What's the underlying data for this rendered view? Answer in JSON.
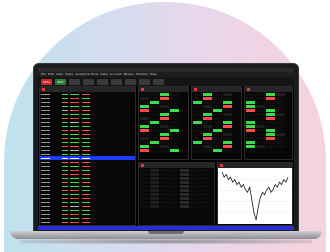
{
  "menu": [
    "File",
    "Edit",
    "View",
    "Trade",
    "Analytical Tools",
    "Data",
    "Account",
    "Mosaic",
    "Window",
    "Help"
  ],
  "toolbar": [
    {
      "label": "SELL",
      "kind": "sell"
    },
    {
      "label": "BUY",
      "kind": "buy"
    },
    {
      "label": "",
      "kind": "btn"
    },
    {
      "label": "",
      "kind": "btn"
    },
    {
      "label": "",
      "kind": "btn"
    },
    {
      "label": "",
      "kind": "btn"
    },
    {
      "label": "",
      "kind": "btn"
    },
    {
      "label": "",
      "kind": "btn"
    },
    {
      "label": "",
      "kind": "btn"
    }
  ],
  "watchlist_rows": [
    {
      "s": "n",
      "c": [
        "pos",
        "pos",
        "neg"
      ]
    },
    {
      "s": "n",
      "c": [
        "pos",
        "neg",
        "pos"
      ]
    },
    {
      "s": "n",
      "c": [
        "neg",
        "neg",
        "neg"
      ]
    },
    {
      "s": "n",
      "c": [
        "pos",
        "pos",
        "pos"
      ]
    },
    {
      "s": "n",
      "c": [
        "neu",
        "neg",
        "neg"
      ]
    },
    {
      "s": "n",
      "c": [
        "pos",
        "pos",
        "pos"
      ]
    },
    {
      "s": "n",
      "c": [
        "neg",
        "neg",
        "pos"
      ]
    },
    {
      "s": "n",
      "c": [
        "pos",
        "neu",
        "neg"
      ]
    },
    {
      "s": "n",
      "c": [
        "pos",
        "pos",
        "pos"
      ]
    },
    {
      "s": "n",
      "c": [
        "neg",
        "neg",
        "neg"
      ]
    },
    {
      "s": "n",
      "c": [
        "pos",
        "pos",
        "neg"
      ]
    },
    {
      "s": "n",
      "c": [
        "neg",
        "pos",
        "pos"
      ]
    },
    {
      "s": "n",
      "c": [
        "pos",
        "pos",
        "pos"
      ]
    },
    {
      "s": "n",
      "c": [
        "neg",
        "neg",
        "pos"
      ]
    },
    {
      "s": "n",
      "c": [
        "pos",
        "neu",
        "neg"
      ]
    },
    {
      "s": "n",
      "c": [
        "pos",
        "pos",
        "pos"
      ]
    },
    {
      "s": "sel",
      "c": [
        "neu",
        "neu",
        "neu"
      ]
    },
    {
      "s": "n",
      "c": [
        "neg",
        "neg",
        "neg"
      ]
    },
    {
      "s": "n",
      "c": [
        "pos",
        "pos",
        "neg"
      ]
    },
    {
      "s": "n",
      "c": [
        "pos",
        "neg",
        "pos"
      ]
    },
    {
      "s": "n",
      "c": [
        "neg",
        "neg",
        "neg"
      ]
    },
    {
      "s": "n",
      "c": [
        "pos",
        "pos",
        "pos"
      ]
    },
    {
      "s": "n",
      "c": [
        "neg",
        "pos",
        "neg"
      ]
    },
    {
      "s": "n",
      "c": [
        "pos",
        "pos",
        "pos"
      ]
    },
    {
      "s": "n",
      "c": [
        "neg",
        "neg",
        "pos"
      ]
    },
    {
      "s": "n",
      "c": [
        "pos",
        "pos",
        "neg"
      ]
    },
    {
      "s": "n",
      "c": [
        "neg",
        "neg",
        "neg"
      ]
    },
    {
      "s": "n",
      "c": [
        "pos",
        "pos",
        "pos"
      ]
    },
    {
      "s": "n",
      "c": [
        "neg",
        "neu",
        "neg"
      ]
    },
    {
      "s": "n",
      "c": [
        "pos",
        "pos",
        "pos"
      ]
    },
    {
      "s": "n",
      "c": [
        "neg",
        "neg",
        "pos"
      ]
    },
    {
      "s": "n",
      "c": [
        "pos",
        "pos",
        "neg"
      ]
    },
    {
      "s": "n",
      "c": [
        "neg",
        "neg",
        "neg"
      ]
    },
    {
      "s": "n",
      "c": [
        "pos",
        "pos",
        "pos"
      ]
    }
  ],
  "colors": {
    "sell": "#c62828",
    "buy": "#2e7d32",
    "accent": "#1f3bff",
    "up": "#3ddc4f",
    "down": "#ff4a4a"
  },
  "chart_line": [
    52,
    50,
    51,
    49,
    50,
    48,
    49,
    47,
    48,
    46,
    47,
    45,
    44,
    46,
    41,
    36,
    33,
    38,
    42,
    44,
    43,
    45,
    46,
    44,
    45,
    47,
    46,
    48,
    47,
    49,
    48,
    50
  ]
}
